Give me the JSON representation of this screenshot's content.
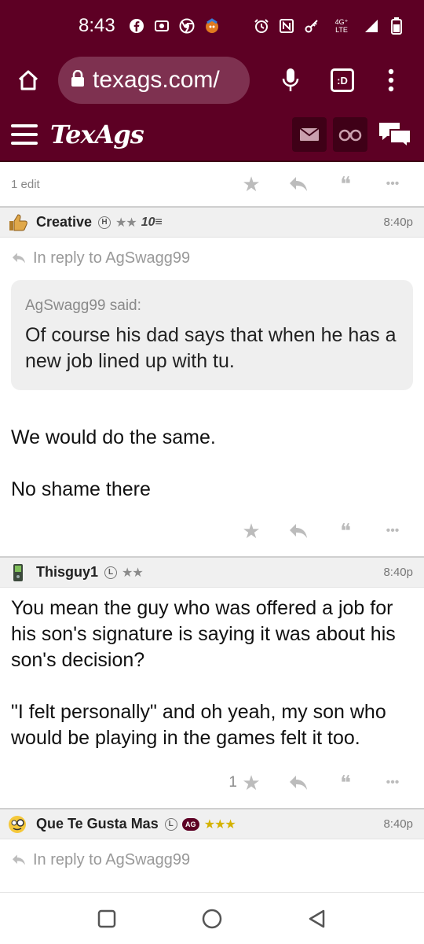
{
  "status_bar": {
    "time": "8:43",
    "network": "4G⁺ LTE"
  },
  "browser": {
    "url": "texags.com/",
    "tab_label": ":D"
  },
  "site": {
    "logo": "TexAgs"
  },
  "post_top": {
    "edit_text": "1 edit"
  },
  "posts": [
    {
      "username": "Creative",
      "badge": "H",
      "stars": "★★",
      "extra_badge": "10",
      "time": "8:40p",
      "reply_to": "In reply to AgSwagg99",
      "quote_author": "AgSwagg99 said:",
      "quote_text": "Of course his dad says that when he has a new job lined up with tu.",
      "body_p1": "We would do the same.",
      "body_p2": "No shame there"
    },
    {
      "username": "Thisguy1",
      "badge": "L",
      "stars": "★★",
      "time": "8:40p",
      "body_p1": "You mean the guy who was offered a job for his son's signature is saying it was about his son's decision?",
      "body_p2": "\"I felt personally\" and oh yeah, my son who would be playing in the games felt it too.",
      "star_count": "1"
    },
    {
      "username": "Que Te Gusta Mas",
      "badge": "L",
      "ag_badge": "AG",
      "stars": "★★★",
      "time": "8:40p",
      "reply_to": "In reply to AgSwagg99"
    }
  ],
  "icons": {
    "star": "★",
    "quote": "❝",
    "more": "•••"
  },
  "colors": {
    "brand_maroon": "#5d0024",
    "gold_star": "#d4b200"
  }
}
